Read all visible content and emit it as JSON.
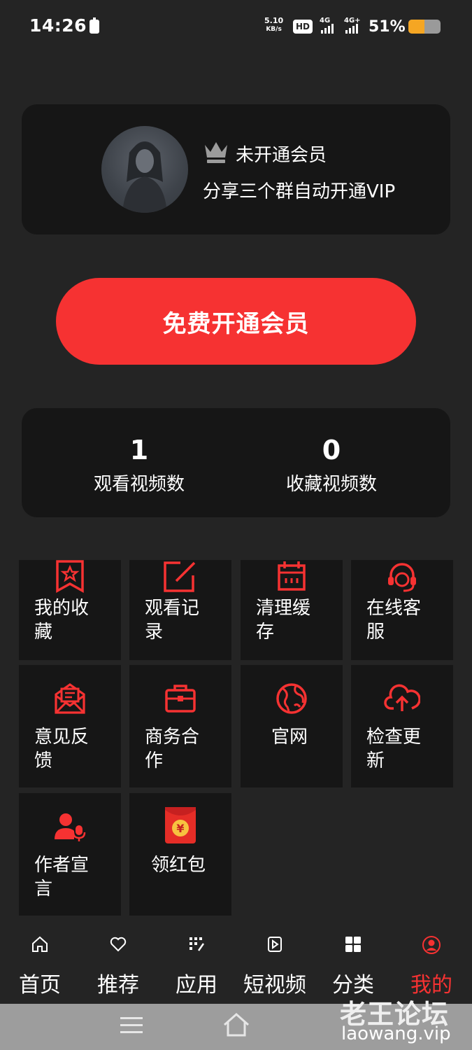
{
  "status_bar": {
    "time": "14:26",
    "speed_value": "5.10",
    "speed_unit": "KB/s",
    "hd_label": "HD",
    "signal1_label": "4G",
    "signal2_label": "4G+",
    "battery_percent": "51%",
    "battery_level": 0.51
  },
  "profile": {
    "member_status": "未开通会员",
    "member_tip": "分享三个群自动开通VIP"
  },
  "vip_button": {
    "label": "免费开通会员"
  },
  "stats": [
    {
      "value": "1",
      "label": "观看视频数"
    },
    {
      "value": "0",
      "label": "收藏视频数"
    }
  ],
  "menu": [
    {
      "label": "我的收藏",
      "icon": "bookmark-star-icon"
    },
    {
      "label": "观看记录",
      "icon": "edit-note-icon"
    },
    {
      "label": "清理缓存",
      "icon": "calendar-clear-icon"
    },
    {
      "label": "在线客服",
      "icon": "headset-service-icon"
    },
    {
      "label": "意见反馈",
      "icon": "mail-feedback-icon"
    },
    {
      "label": "商务合作",
      "icon": "briefcase-icon"
    },
    {
      "label": "官网",
      "icon": "globe-icon"
    },
    {
      "label": "检查更新",
      "icon": "cloud-upload-icon"
    },
    {
      "label": "作者宣言",
      "icon": "user-mic-icon"
    },
    {
      "label": "领红包",
      "icon": "red-envelope-icon"
    }
  ],
  "menu_label_lines": [
    [
      "我的收",
      "藏"
    ],
    [
      "观看记",
      "录"
    ],
    [
      "清理缓",
      "存"
    ],
    [
      "在线客",
      "服"
    ],
    [
      "意见反",
      "馈"
    ],
    [
      "商务合",
      "作"
    ],
    [
      "官网"
    ],
    [
      "检查更",
      "新"
    ],
    [
      "作者宣",
      "言"
    ],
    [
      "领红包"
    ]
  ],
  "bottom_nav": [
    {
      "label": "首页",
      "icon": "home-icon"
    },
    {
      "label": "推荐",
      "icon": "heart-icon"
    },
    {
      "label": "应用",
      "icon": "apps-icon"
    },
    {
      "label": "短视频",
      "icon": "play-video-icon"
    },
    {
      "label": "分类",
      "icon": "category-grid-icon"
    },
    {
      "label": "我的",
      "icon": "user-profile-icon",
      "active": true
    }
  ],
  "watermark": {
    "text": "老王论坛",
    "url": "laowang.vip"
  },
  "colors": {
    "accent": "#f63232",
    "background": "#242424",
    "card": "#161616"
  }
}
